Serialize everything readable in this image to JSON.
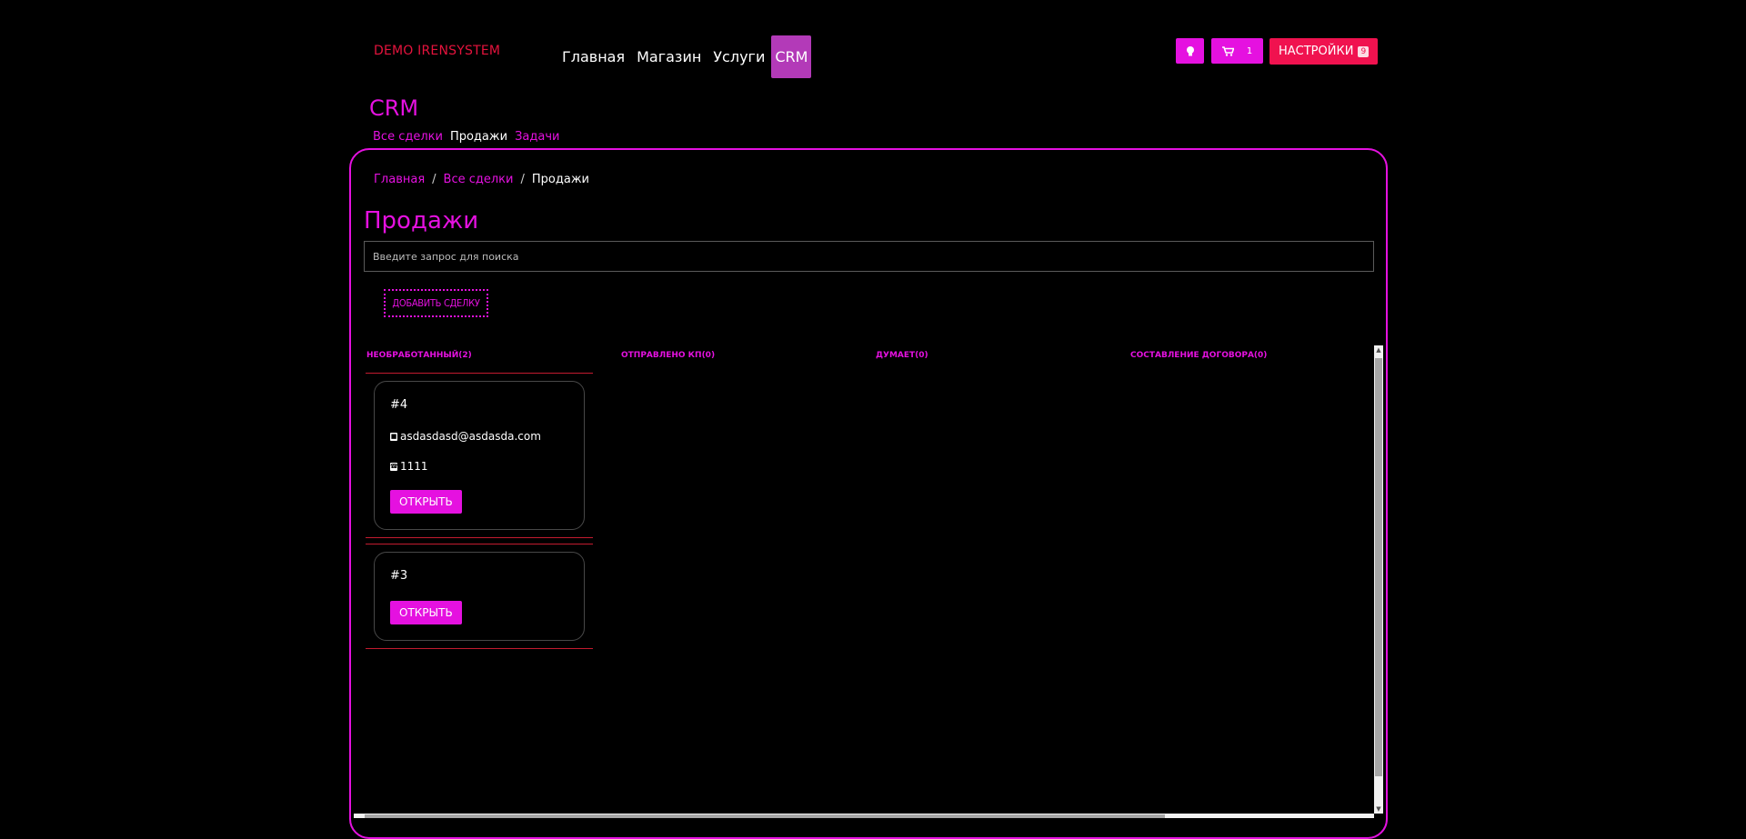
{
  "header": {
    "brand": "DEMO IRENSYSTEM",
    "nav": [
      {
        "label": "Главная"
      },
      {
        "label": "Магазин"
      },
      {
        "label": "Услуги"
      },
      {
        "label": "CRM",
        "active": true
      }
    ],
    "cart_count": "1",
    "settings_label": "НАСТРОЙКИ",
    "settings_badge": "9"
  },
  "section": {
    "title": "CRM",
    "subnav": [
      "Все сделки",
      "Продажи",
      "Задачи"
    ]
  },
  "breadcrumb": {
    "home": "Главная",
    "sep": "/",
    "all": "Все сделки",
    "current": "Продажи"
  },
  "page": {
    "title": "Продажи",
    "search_placeholder": "Введите запрос для поиска",
    "add_deal_label": "ДОБАВИТЬ СДЕЛКУ"
  },
  "columns": [
    {
      "header": "НЕОБРАБОТАННЫЙ(2)"
    },
    {
      "header": "ОТПРАВЛЕНО КП(0)"
    },
    {
      "header": "ДУМАЕТ(0)"
    },
    {
      "header": "СОСТАВЛЕНИЕ ДОГОВОРА(0)"
    }
  ],
  "cards": [
    {
      "id": "#4",
      "email": "asdasdasd@asdasda.com",
      "phone": "1111",
      "button": "ОТКРЫТЬ"
    },
    {
      "id": "#3",
      "button": "ОТКРЫТЬ"
    }
  ],
  "colors": {
    "accent": "#e511e0",
    "danger": "#f0124f",
    "brand_text": "#e5133d",
    "active_nav": "#b33ab8",
    "background": "#000000"
  },
  "icons": [
    "bulb-icon",
    "cart-icon",
    "user-icon",
    "phone-icon"
  ]
}
